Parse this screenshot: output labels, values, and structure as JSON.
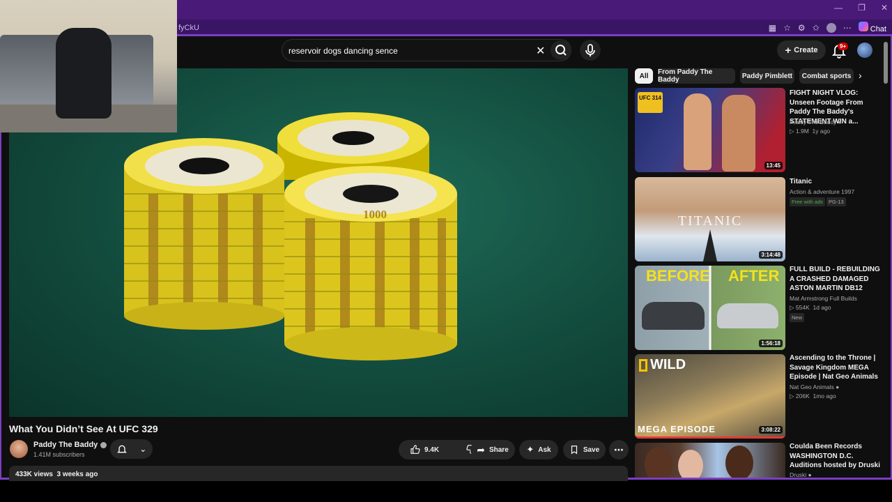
{
  "browser": {
    "url": "fyCkU",
    "chat_label": "Chat",
    "window_controls": [
      "—",
      "❐",
      "✕"
    ]
  },
  "header": {
    "search_value": "reservoir dogs dancing sence",
    "create_label": "Create",
    "notifications_badge": "9+"
  },
  "video": {
    "title": "What You Didn’t See At UFC 329",
    "channel": "Paddy The Baddy",
    "subscribers": "1.41M subscribers",
    "likes": "9.4K",
    "share_label": "Share",
    "ask_label": "Ask",
    "save_label": "Save",
    "views": "433K views",
    "age": "3 weeks ago",
    "chip_value": "1000"
  },
  "chips": [
    "All",
    "From Paddy The Baddy",
    "Paddy Pimblett",
    "Combat sports"
  ],
  "recommendations": [
    {
      "title": "FIGHT NIGHT VLOG: Unseen Footage From Paddy The Baddy's STATEMENT WIN a...",
      "channel": "Paddy The Baddy",
      "views": "1.9M",
      "age": "1y ago",
      "duration": "13:45",
      "badge": "UFC 314"
    },
    {
      "title": "Titanic",
      "channel": "Action & adventure 1997",
      "free_label": "Free with ads",
      "rating": "PG-13",
      "duration": "3:14:48",
      "thumb_text": "TITANIC"
    },
    {
      "title": "FULL BUILD - REBUILDING A CRASHED DAMAGED ASTON MARTIN DB12",
      "channel": "Mat Armstrong Full Builds",
      "views": "554K",
      "age": "1d ago",
      "new_label": "New",
      "duration": "1:56:18",
      "thumb_left": "BEFORE",
      "thumb_right": "AFTER"
    },
    {
      "title": "Ascending to the Throne | Savage Kingdom MEGA Episode | Nat Geo Animals",
      "channel": "Nat Geo Animals",
      "views": "206K",
      "age": "1mo ago",
      "duration": "3:08:22",
      "thumb_top": "WILD",
      "thumb_bottom": "MEGA EPISODE"
    },
    {
      "title": "Coulda Been Records WASHINGTON D.C. Auditions hosted by Druski",
      "channel": "Druski"
    }
  ]
}
